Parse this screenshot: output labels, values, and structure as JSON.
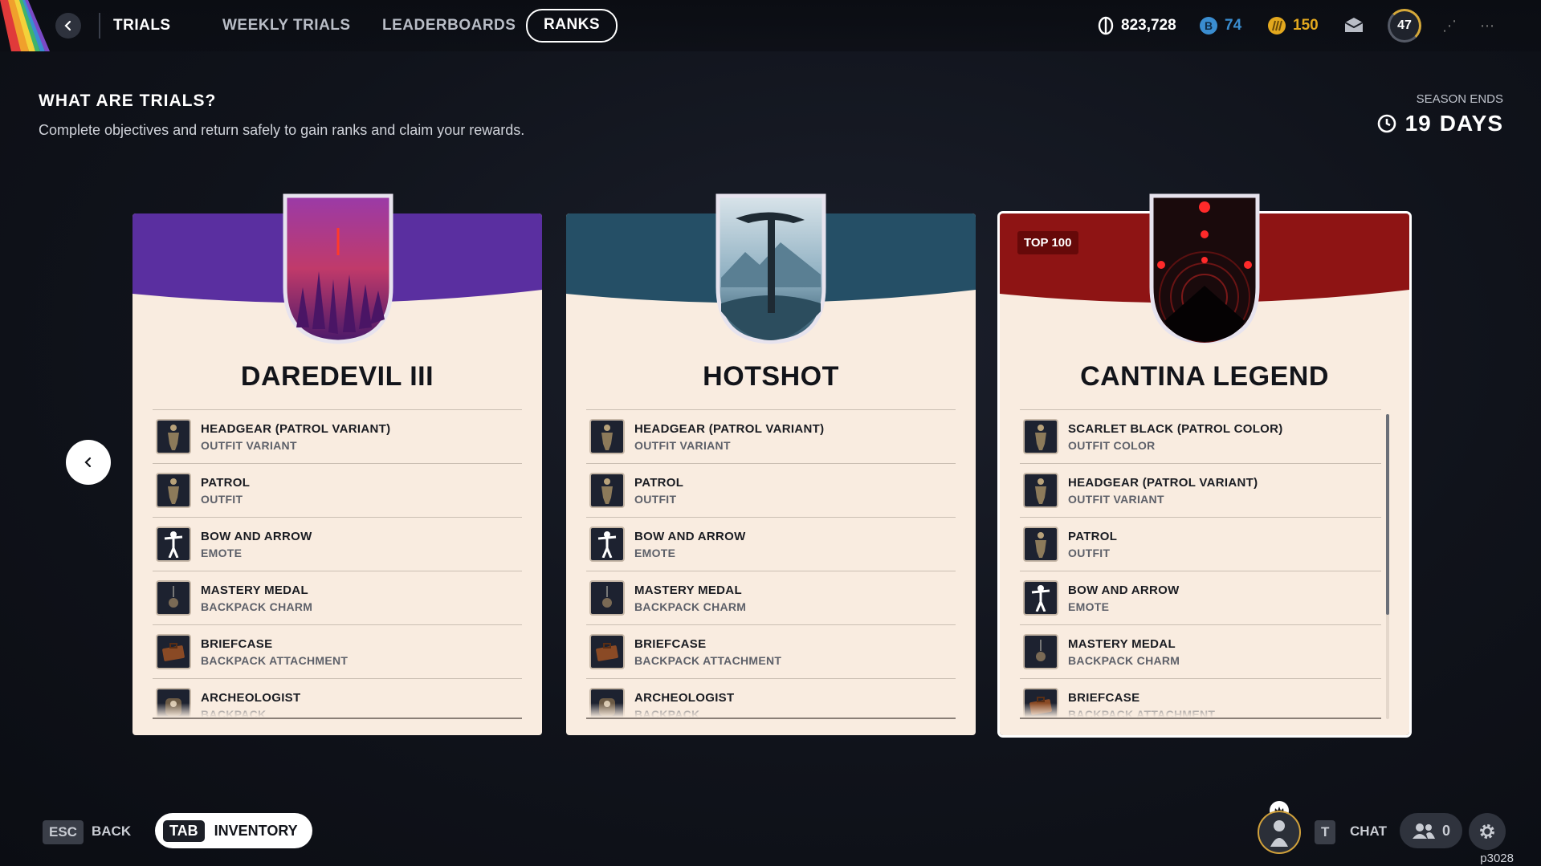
{
  "nav": {
    "tabs": [
      "TRIALS",
      "WEEKLY TRIALS",
      "LEADERBOARDS",
      "RANKS"
    ],
    "active_tab": "RANKS"
  },
  "currencies": {
    "credits": "823,728",
    "tokens": "74",
    "gold": "150",
    "level": "47"
  },
  "info": {
    "title": "WHAT ARE TRIALS?",
    "description": "Complete objectives and return safely to gain ranks and claim your rewards."
  },
  "season": {
    "label": "SEASON ENDS",
    "days": "19",
    "unit": "DAYS"
  },
  "cards": [
    {
      "title": "DAREDEVIL III",
      "badge": "",
      "rewards": [
        {
          "name": "HEADGEAR (PATROL VARIANT)",
          "type": "OUTFIT VARIANT",
          "icon": "soldier-icon"
        },
        {
          "name": "PATROL",
          "type": "OUTFIT",
          "icon": "soldier-icon"
        },
        {
          "name": "BOW AND ARROW",
          "type": "EMOTE",
          "icon": "emote-figure-icon"
        },
        {
          "name": "MASTERY MEDAL",
          "type": "BACKPACK CHARM",
          "icon": "medal-icon"
        },
        {
          "name": "BRIEFCASE",
          "type": "BACKPACK ATTACHMENT",
          "icon": "briefcase-icon"
        },
        {
          "name": "ARCHEOLOGIST",
          "type": "BACKPACK",
          "icon": "backpack-icon"
        }
      ]
    },
    {
      "title": "HOTSHOT",
      "badge": "",
      "rewards": [
        {
          "name": "HEADGEAR (PATROL VARIANT)",
          "type": "OUTFIT VARIANT",
          "icon": "soldier-icon"
        },
        {
          "name": "PATROL",
          "type": "OUTFIT",
          "icon": "soldier-icon"
        },
        {
          "name": "BOW AND ARROW",
          "type": "EMOTE",
          "icon": "emote-figure-icon"
        },
        {
          "name": "MASTERY MEDAL",
          "type": "BACKPACK CHARM",
          "icon": "medal-icon"
        },
        {
          "name": "BRIEFCASE",
          "type": "BACKPACK ATTACHMENT",
          "icon": "briefcase-icon"
        },
        {
          "name": "ARCHEOLOGIST",
          "type": "BACKPACK",
          "icon": "backpack-icon"
        }
      ]
    },
    {
      "title": "CANTINA LEGEND",
      "badge": "TOP 100",
      "rewards": [
        {
          "name": "SCARLET BLACK (PATROL COLOR)",
          "type": "OUTFIT COLOR",
          "icon": "soldier-icon"
        },
        {
          "name": "HEADGEAR (PATROL VARIANT)",
          "type": "OUTFIT VARIANT",
          "icon": "soldier-icon"
        },
        {
          "name": "PATROL",
          "type": "OUTFIT",
          "icon": "soldier-icon"
        },
        {
          "name": "BOW AND ARROW",
          "type": "EMOTE",
          "icon": "emote-figure-icon"
        },
        {
          "name": "MASTERY MEDAL",
          "type": "BACKPACK CHARM",
          "icon": "medal-icon"
        },
        {
          "name": "BRIEFCASE",
          "type": "BACKPACK ATTACHMENT",
          "icon": "briefcase-icon"
        }
      ]
    }
  ],
  "footer": {
    "back_key": "ESC",
    "back_label": "BACK",
    "inventory_key": "TAB",
    "inventory_label": "INVENTORY",
    "chat_key": "T",
    "chat_label": "CHAT",
    "friends_count": "0",
    "build_id": "p3028"
  },
  "colors": {
    "daredevil_banner": "#5a2fa0",
    "hotshot_banner": "#254f66",
    "cantina_banner": "#8e1414",
    "card_bg": "#f9ece0",
    "token_blue": "#3a8dd0",
    "gold": "#e3a81e"
  }
}
